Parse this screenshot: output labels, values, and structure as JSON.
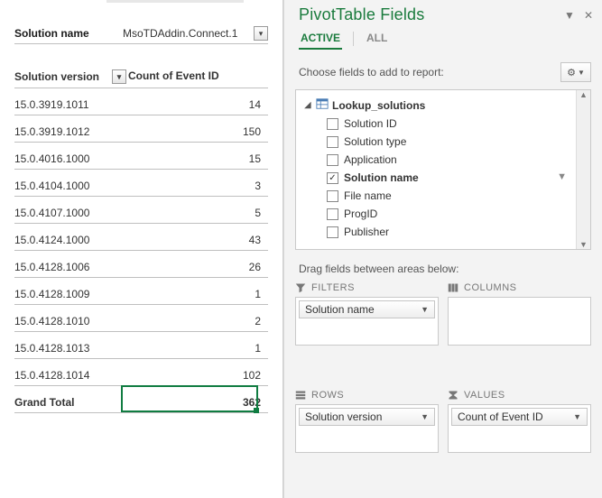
{
  "pivot_filter": {
    "label": "Solution name",
    "value": "MsoTDAddin.Connect.1"
  },
  "pivot_headers": {
    "row_label": "Solution version",
    "value_label": "Count of Event ID"
  },
  "pivot_rows": [
    {
      "label": "15.0.3919.1011",
      "value": 14
    },
    {
      "label": "15.0.3919.1012",
      "value": 150
    },
    {
      "label": "15.0.4016.1000",
      "value": 15
    },
    {
      "label": "15.0.4104.1000",
      "value": 3
    },
    {
      "label": "15.0.4107.1000",
      "value": 5
    },
    {
      "label": "15.0.4124.1000",
      "value": 43
    },
    {
      "label": "15.0.4128.1006",
      "value": 26
    },
    {
      "label": "15.0.4128.1009",
      "value": 1
    },
    {
      "label": "15.0.4128.1010",
      "value": 2
    },
    {
      "label": "15.0.4128.1013",
      "value": 1
    },
    {
      "label": "15.0.4128.1014",
      "value": 102
    }
  ],
  "grand_total": {
    "label": "Grand Total",
    "value": 362
  },
  "pane": {
    "title": "PivotTable Fields",
    "tabs": {
      "active": "ACTIVE",
      "all": "ALL"
    },
    "choose_text": "Choose fields to add to report:",
    "table_name": "Lookup_solutions",
    "fields": [
      {
        "name": "Solution ID",
        "checked": false
      },
      {
        "name": "Solution type",
        "checked": false
      },
      {
        "name": "Application",
        "checked": false
      },
      {
        "name": "Solution name",
        "checked": true,
        "filtered": true
      },
      {
        "name": "File name",
        "checked": false
      },
      {
        "name": "ProgID",
        "checked": false
      },
      {
        "name": "Publisher",
        "checked": false
      }
    ],
    "drag_text": "Drag fields between areas below:",
    "areas": {
      "filters": {
        "title": "FILTERS",
        "items": [
          "Solution name"
        ]
      },
      "columns": {
        "title": "COLUMNS",
        "items": []
      },
      "rows": {
        "title": "ROWS",
        "items": [
          "Solution version"
        ]
      },
      "values": {
        "title": "VALUES",
        "items": [
          "Count of Event ID"
        ]
      }
    }
  }
}
